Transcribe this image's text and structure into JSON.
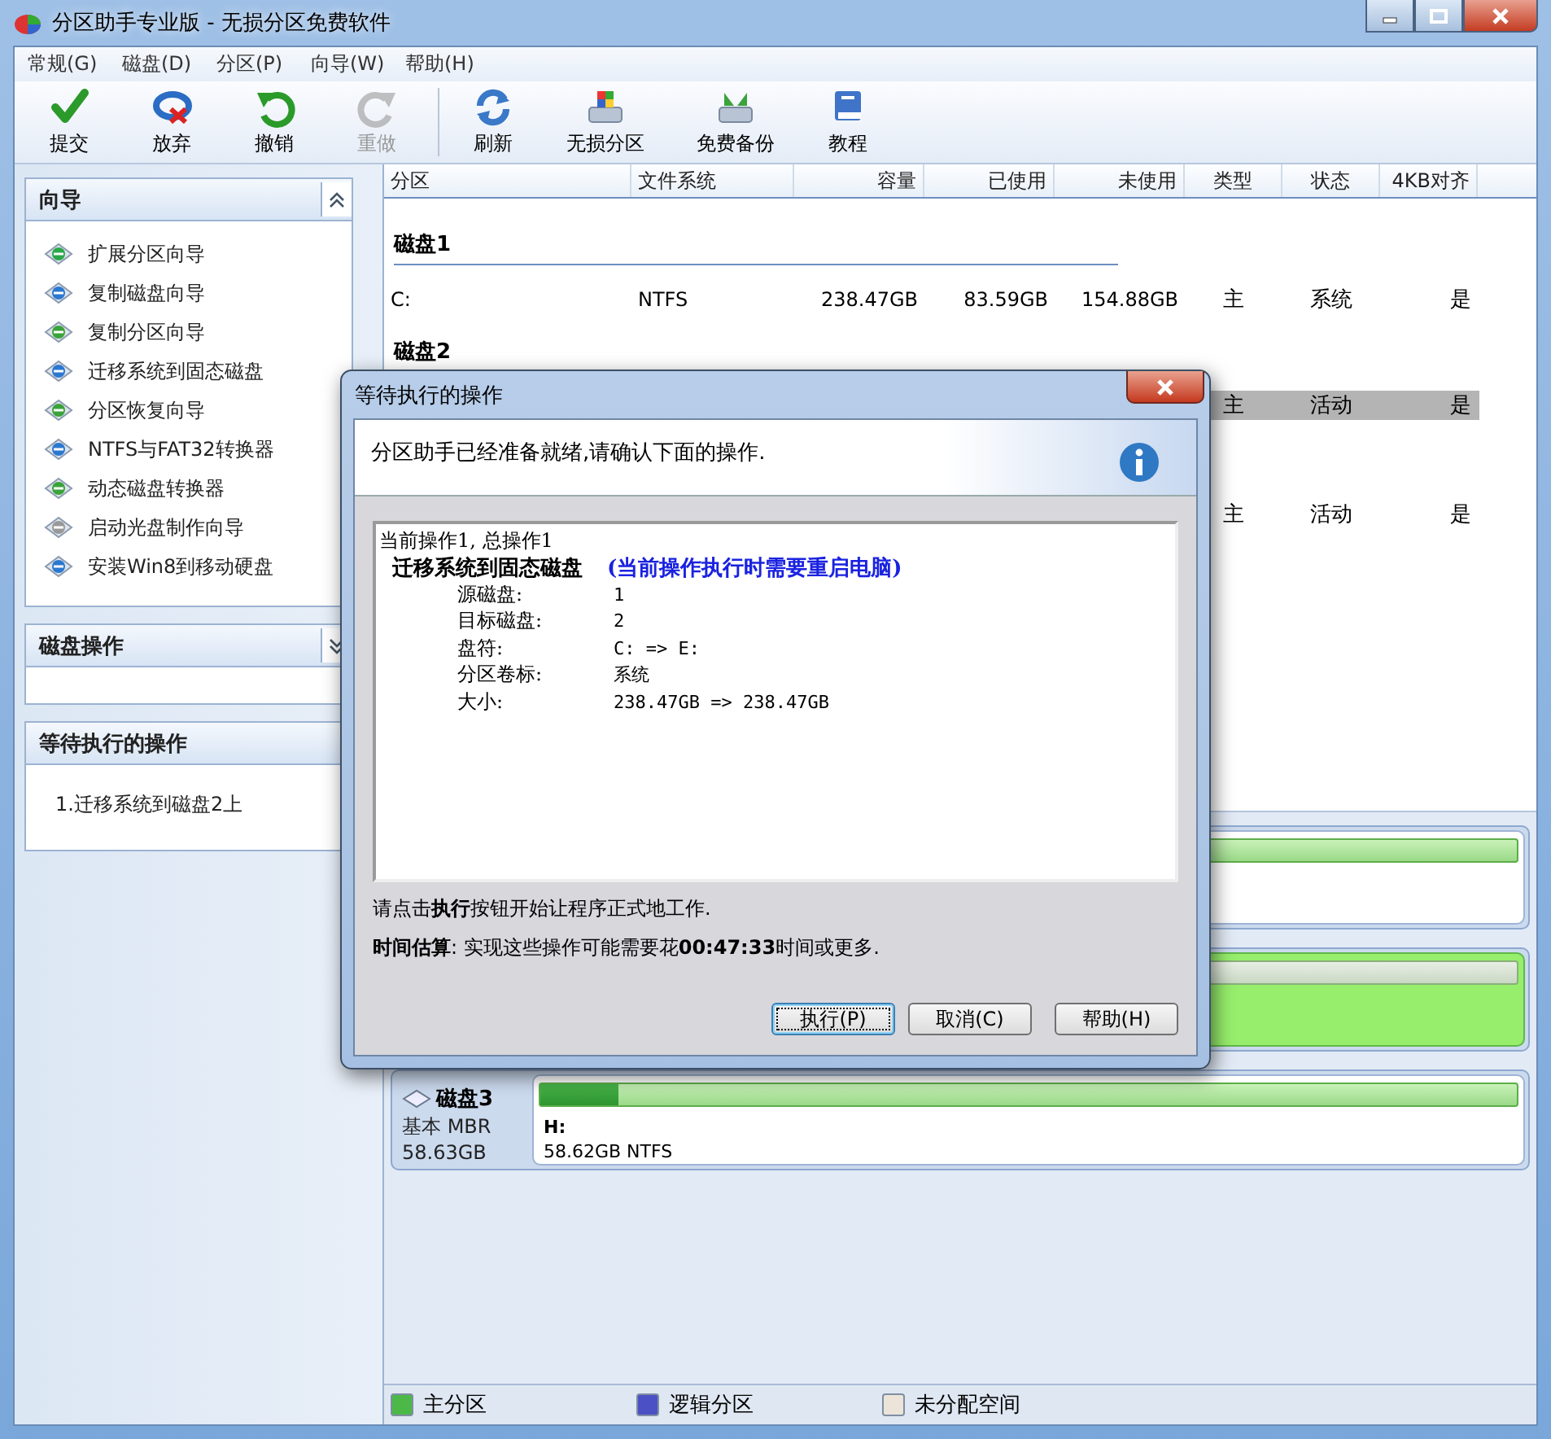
{
  "window": {
    "title": "分区助手专业版 - 无损分区免费软件"
  },
  "menu": [
    "常规(G)",
    "磁盘(D)",
    "分区(P)",
    "向导(W)",
    "帮助(H)"
  ],
  "toolbar": [
    [
      {
        "label": "提交",
        "disabled": false
      },
      {
        "label": "放弃",
        "disabled": false
      },
      {
        "label": "撤销",
        "disabled": false
      },
      {
        "label": "重做",
        "disabled": true
      }
    ],
    [
      {
        "label": "刷新",
        "disabled": false
      },
      {
        "label": "无损分区",
        "disabled": false
      },
      {
        "label": "免费备份",
        "disabled": false
      },
      {
        "label": "教程",
        "disabled": false
      }
    ]
  ],
  "sidebar": {
    "panels": [
      {
        "title": "向导",
        "expanded": true,
        "items": [
          "扩展分区向导",
          "复制磁盘向导",
          "复制分区向导",
          "迁移系统到固态磁盘",
          "分区恢复向导",
          "NTFS与FAT32转换器",
          "动态磁盘转换器",
          "启动光盘制作向导",
          "安装Win8到移动硬盘"
        ]
      },
      {
        "title": "磁盘操作",
        "expanded": false
      },
      {
        "title": "等待执行的操作",
        "items": [
          "1.迁移系统到磁盘2上"
        ]
      }
    ]
  },
  "table": {
    "columns": [
      "分区",
      "文件系统",
      "容量",
      "已使用",
      "未使用",
      "类型",
      "状态",
      "4KB对齐"
    ],
    "rows": [
      {
        "kind": "group",
        "label": "磁盘1"
      },
      {
        "kind": "partition",
        "selected": false,
        "cells": {
          "partition": "C:",
          "file_system": "NTFS",
          "capacity": "238.47GB",
          "used": "83.59GB",
          "free": "154.88GB",
          "type": "主",
          "status": "系统",
          "aligned": "是"
        }
      },
      {
        "kind": "group",
        "label": "磁盘2"
      },
      {
        "kind": "partition",
        "selected": true,
        "cells": {
          "type": "主",
          "status": "活动",
          "aligned": "是"
        }
      },
      {
        "kind": "group"
      },
      {
        "kind": "partition",
        "selected": false,
        "cells": {
          "type": "主",
          "status": "活动",
          "aligned": "是"
        }
      }
    ]
  },
  "disk_map": [
    {
      "partitions": [
        {
          "selected": false
        }
      ]
    },
    {
      "partitions": [
        {
          "selected": true
        }
      ]
    },
    {
      "name": "磁盘3",
      "type": "基本 MBR",
      "size": "58.63GB",
      "partitions": [
        {
          "selected": false,
          "letter": "H:",
          "info": "58.62GB NTFS",
          "level": 0.08
        }
      ]
    }
  ],
  "legend": [
    {
      "label": "主分区",
      "color": "#4cb848"
    },
    {
      "label": "逻辑分区",
      "color": "#4b50c4"
    },
    {
      "label": "未分配空间",
      "color": "#ece4d8"
    }
  ],
  "dialog": {
    "title": "等待执行的操作",
    "message": "分区助手已经准备就绪,请确认下面的操作.",
    "summary": "当前操作1, 总操作1",
    "operation": "迁移系统到固态磁盘",
    "note": "(当前操作执行时需要重启电脑)",
    "details": [
      {
        "label": "源磁盘:",
        "value": "1"
      },
      {
        "label": "目标磁盘:",
        "value": "2"
      },
      {
        "label": "盘符:",
        "value": "C: => E:"
      },
      {
        "label": "分区卷标:",
        "value": "系统"
      },
      {
        "label": "大小:",
        "value": "238.47GB => 238.47GB"
      }
    ],
    "instruction": "请点击**执行**按钮开始让程序正式地工作.",
    "estimate": "**时间估算**: 实现这些操作可能需要花**00:47:33**时间或更多.",
    "buttons": [
      {
        "label": "执行(P)",
        "default": true
      },
      {
        "label": "取消(C)",
        "default": false
      },
      {
        "label": "帮助(H)",
        "default": false
      }
    ]
  }
}
